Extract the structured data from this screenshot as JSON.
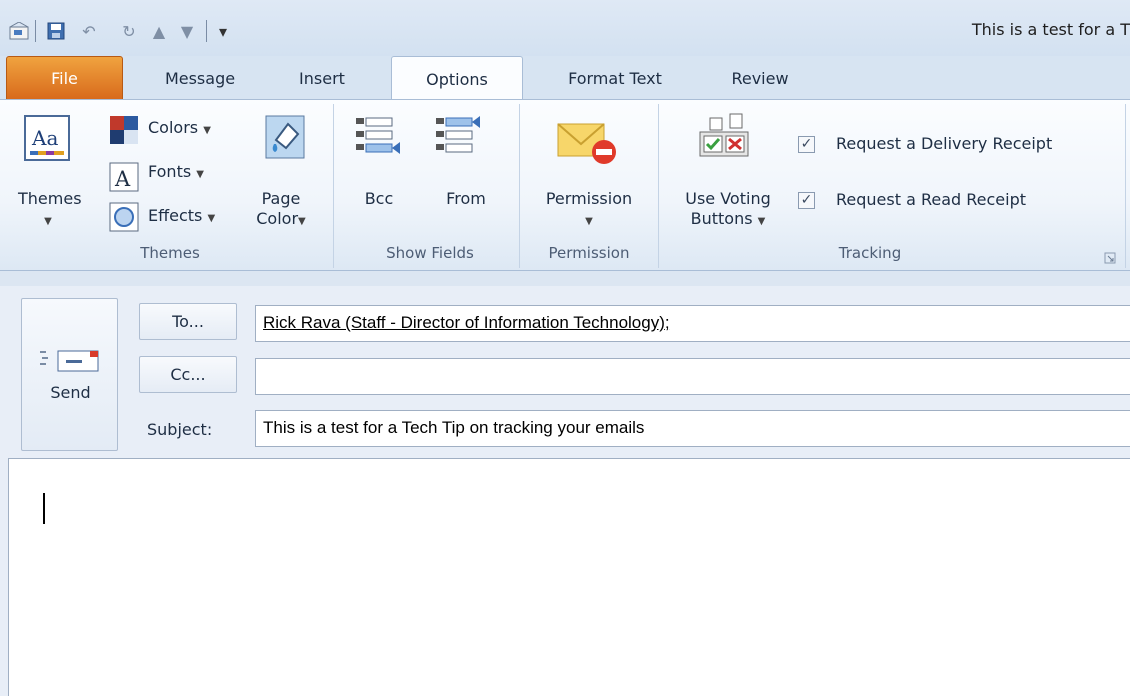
{
  "window": {
    "title": "This is a test for a T"
  },
  "quick_access": {
    "icons": [
      "outlook-icon",
      "save-icon",
      "undo-icon",
      "redo-icon",
      "up-arrow-icon",
      "down-arrow-icon",
      "customize-icon"
    ]
  },
  "tabs": [
    {
      "label": "File"
    },
    {
      "label": "Message"
    },
    {
      "label": "Insert"
    },
    {
      "label": "Options",
      "active": true
    },
    {
      "label": "Format Text"
    },
    {
      "label": "Review"
    }
  ],
  "ribbon": {
    "themes_group": {
      "label": "Themes",
      "themes_button": "Themes",
      "colors": "Colors",
      "fonts": "Fonts",
      "effects": "Effects",
      "page_color_line1": "Page",
      "page_color_line2": "Color"
    },
    "show_fields_group": {
      "label": "Show Fields",
      "bcc": "Bcc",
      "from": "From"
    },
    "permission_group": {
      "label": "Permission",
      "permission_button": "Permission"
    },
    "tracking_group": {
      "label": "Tracking",
      "voting_line1": "Use Voting",
      "voting_line2": "Buttons",
      "delivery_receipt": "Request a Delivery Receipt",
      "delivery_checked": true,
      "read_receipt": "Request a Read Receipt",
      "read_checked": true
    }
  },
  "compose": {
    "send_label": "Send",
    "to_button": "To...",
    "cc_button": "Cc...",
    "subject_label": "Subject:",
    "to_value": "Rick Rava (Staff - Director of Information Technology)",
    "to_suffix": ";",
    "cc_value": "",
    "subject_value": "This is a test for a Tech Tip on tracking your emails"
  },
  "colors": {
    "file_tab": "#d86a1c",
    "ribbon_bg": "#f0f5fb",
    "header_bg": "#e8eef7"
  }
}
